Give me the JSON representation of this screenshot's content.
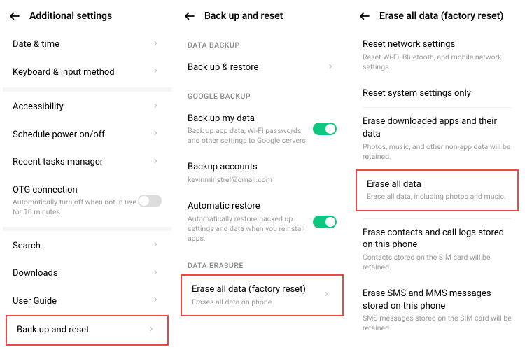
{
  "panel1": {
    "title": "Additional settings",
    "items": {
      "datetime": "Date & time",
      "keyboard": "Keyboard & input method",
      "accessibility": "Accessibility",
      "schedule": "Schedule power on/off",
      "recent": "Recent tasks manager",
      "otg": {
        "title": "OTG connection",
        "sub": "Automatically turn off when not in use for 10 minutes."
      },
      "search": "Search",
      "downloads": "Downloads",
      "userguide": "User Guide",
      "backup": "Back up and reset"
    }
  },
  "panel2": {
    "title": "Back up and reset",
    "sections": {
      "databackup": "DATA BACKUP",
      "google": "GOOGLE BACKUP",
      "erasure": "DATA ERASURE"
    },
    "items": {
      "backup_restore": "Back up & restore",
      "backup_my_data": {
        "title": "Back up my data",
        "sub": "Back up app data, Wi-Fi passwords, and other settings to Google servers"
      },
      "backup_accounts": {
        "title": "Backup accounts",
        "sub": "kevinminstrel@gmail.com"
      },
      "auto_restore": {
        "title": "Automatic restore",
        "sub": "Automatically restore backed up settings and data when you reinstall apps."
      },
      "erase_all": {
        "title": "Erase all data (factory reset)",
        "sub": "Erases all data on phone"
      }
    }
  },
  "panel3": {
    "title": "Erase all data (factory reset)",
    "items": {
      "reset_net": {
        "title": "Reset network settings",
        "sub": "Reset Wi-Fi, Bluetooth, and mobile network settings."
      },
      "reset_sys": "Reset system settings only",
      "erase_apps": {
        "title": "Erase downloaded apps and their data",
        "sub": "Photos, music, and other non-app data will be retained."
      },
      "erase_all": {
        "title": "Erase all data",
        "sub": "Erase all data, including photos and music."
      },
      "erase_contacts": {
        "title": "Erase contacts and call logs stored on this phone",
        "sub": "Contacts stored on the SIM card will be retained."
      },
      "erase_sms": {
        "title": "Erase SMS and MMS messages stored on this phone",
        "sub": "SMS messages stored on the SIM card will be retained."
      }
    }
  }
}
